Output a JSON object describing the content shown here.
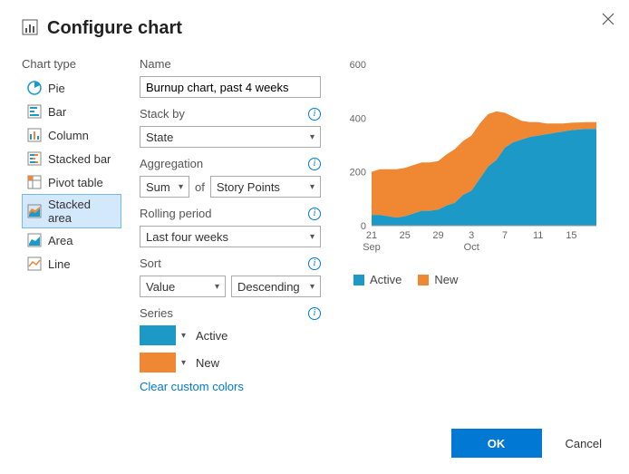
{
  "dialog": {
    "title": "Configure chart"
  },
  "sidebar": {
    "label": "Chart type",
    "items": [
      {
        "label": "Pie"
      },
      {
        "label": "Bar"
      },
      {
        "label": "Column"
      },
      {
        "label": "Stacked bar"
      },
      {
        "label": "Pivot table"
      },
      {
        "label": "Stacked area"
      },
      {
        "label": "Area"
      },
      {
        "label": "Line"
      }
    ],
    "selected_index": 5
  },
  "form": {
    "name_label": "Name",
    "name_value": "Burnup chart, past 4 weeks",
    "stackby_label": "Stack by",
    "stackby_value": "State",
    "aggregation_label": "Aggregation",
    "aggregation_value": "Sum",
    "aggregation_joiner": "of",
    "aggregation_field": "Story Points",
    "rolling_label": "Rolling period",
    "rolling_value": "Last four weeks",
    "sort_label": "Sort",
    "sort_by": "Value",
    "sort_dir": "Descending",
    "series_label": "Series",
    "series": [
      {
        "name": "Active",
        "color": "#1c99c6"
      },
      {
        "name": "New",
        "color": "#f08733"
      }
    ],
    "clear_colors": "Clear custom colors"
  },
  "buttons": {
    "ok": "OK",
    "cancel": "Cancel"
  },
  "chart_data": {
    "type": "area",
    "title": "",
    "xlabel": "",
    "ylabel": "",
    "ylim": [
      0,
      600
    ],
    "yticks": [
      0,
      200,
      400,
      600
    ],
    "x": [
      "21 Sep",
      "22",
      "23",
      "24",
      "25",
      "26",
      "27",
      "28",
      "29",
      "30",
      "1",
      "2",
      "3 Oct",
      "4",
      "5",
      "6",
      "7",
      "8",
      "9",
      "10",
      "11",
      "12",
      "13",
      "14",
      "15",
      "16",
      "17",
      "18"
    ],
    "xticks_labels": [
      "21",
      "25",
      "29",
      "3",
      "7",
      "11",
      "15"
    ],
    "xticks_month": [
      "Sep",
      "",
      "",
      "Oct",
      "",
      "",
      ""
    ],
    "series": [
      {
        "name": "Active",
        "color": "#1c99c6",
        "values": [
          40,
          40,
          35,
          30,
          35,
          45,
          55,
          55,
          60,
          75,
          85,
          115,
          130,
          175,
          220,
          245,
          290,
          310,
          320,
          330,
          335,
          340,
          345,
          350,
          355,
          358,
          360,
          360
        ]
      },
      {
        "name": "New",
        "color": "#f08733",
        "values": [
          160,
          170,
          175,
          180,
          180,
          180,
          180,
          180,
          180,
          190,
          200,
          200,
          205,
          205,
          195,
          180,
          130,
          95,
          70,
          55,
          50,
          40,
          35,
          30,
          28,
          26,
          25,
          25
        ]
      }
    ],
    "legend": [
      "Active",
      "New"
    ]
  }
}
